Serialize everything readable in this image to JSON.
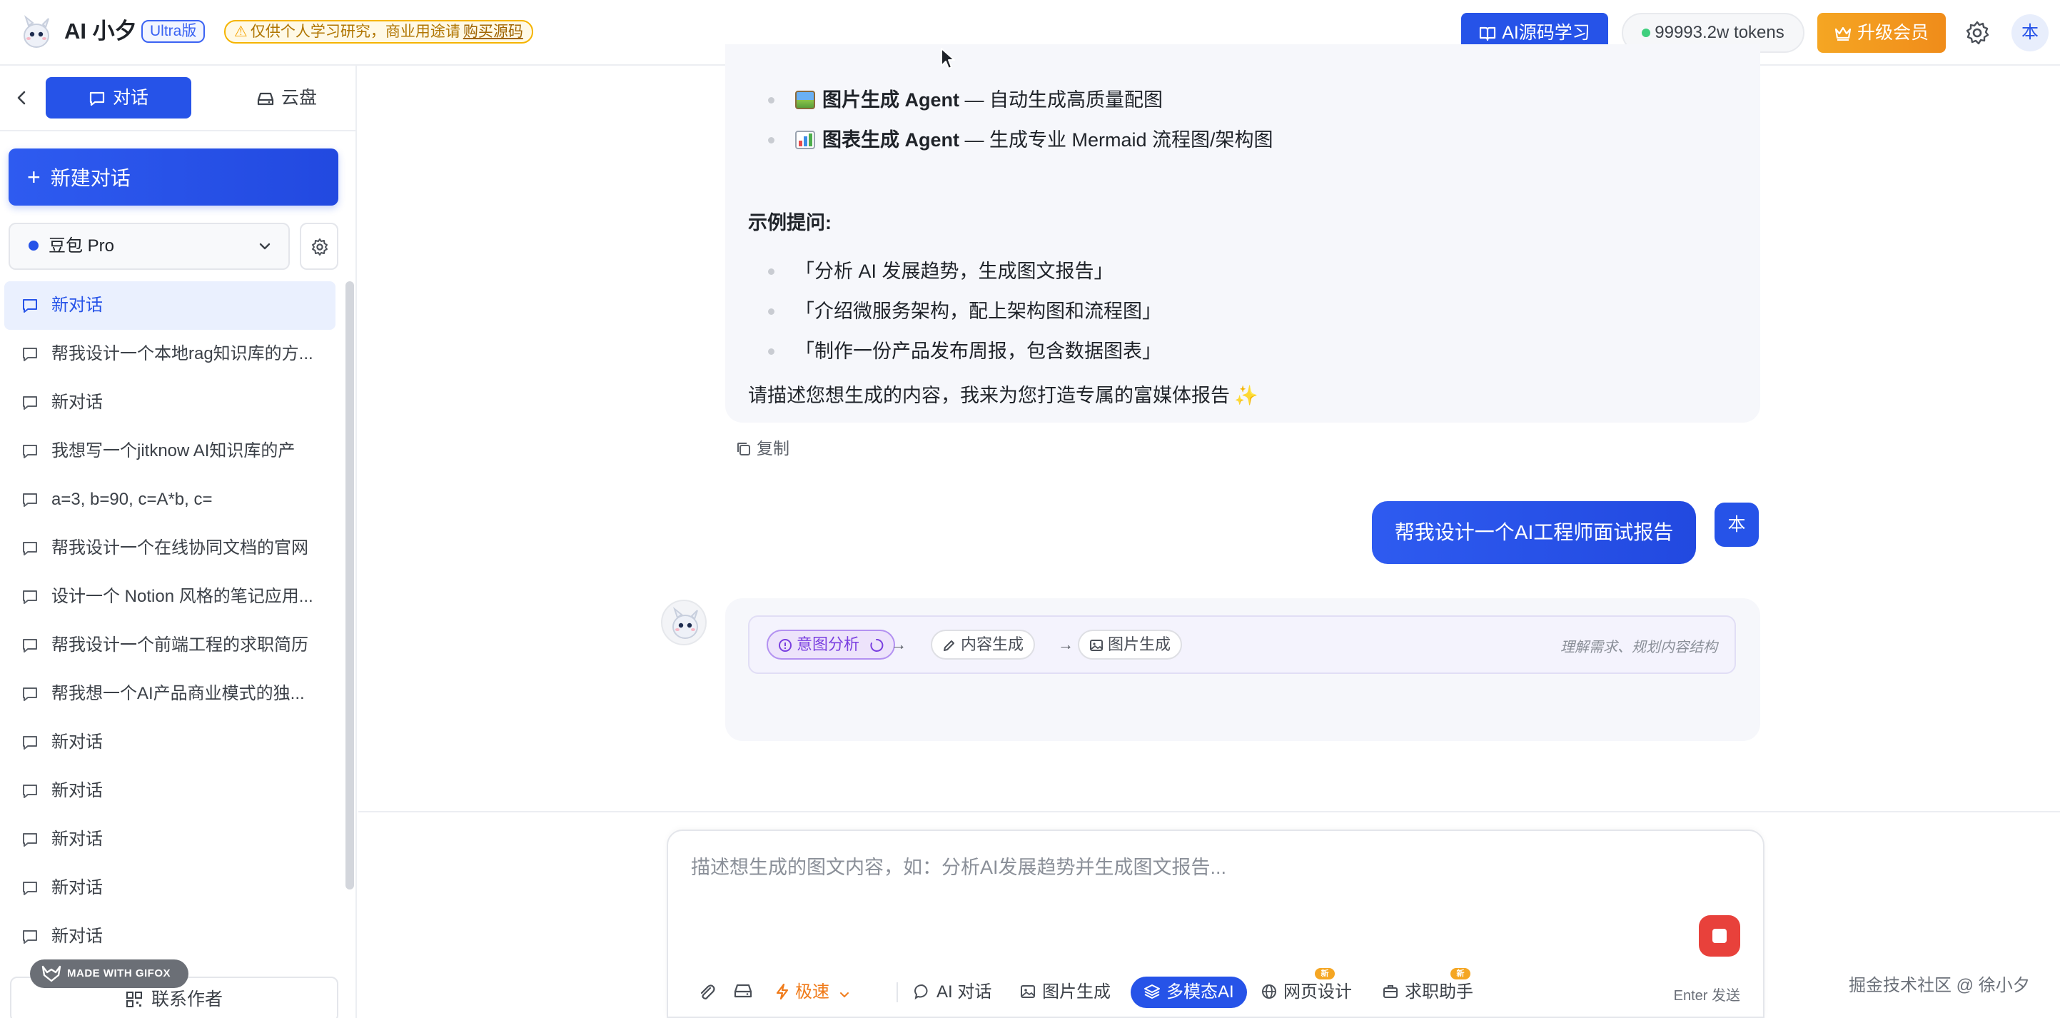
{
  "header": {
    "app_name": "AI 小夕",
    "edition_badge": "Ultra版",
    "notice_text": "仅供个人学习研究，商业用途请",
    "notice_link": "购买源码",
    "source_button": "AI源码学习",
    "tokens": "99993.2w tokens",
    "upgrade_button": "升级会员",
    "user_avatar": "本"
  },
  "sidebar": {
    "tab_chat": "对话",
    "tab_cloud": "云盘",
    "new_chat": "新建对话",
    "model": "豆包 Pro",
    "conversations": [
      "新对话",
      "帮我设计一个本地rag知识库的方...",
      "新对话",
      "我想写一个jitknow AI知识库的产",
      "a=3, b=90, c=A*b, c=",
      "帮我设计一个在线协同文档的官网",
      "设计一个 Notion 风格的笔记应用...",
      "帮我设计一个前端工程的求职简历",
      "帮我想一个AI产品商业模式的独...",
      "新对话",
      "新对话",
      "新对话",
      "新对话",
      "新对话"
    ],
    "gifox": "MADE WITH GIFOX",
    "contact": "联系作者"
  },
  "chat": {
    "agents": [
      {
        "name": "图片生成 Agent",
        "desc": " — 自动生成高质量配图"
      },
      {
        "name": "图表生成 Agent",
        "desc": " — 生成专业 Mermaid 流程图/架构图"
      }
    ],
    "examples_title": "示例提问:",
    "examples": [
      "「分析 AI 发展趋势，生成图文报告」",
      "「介绍微服务架构，配上架构图和流程图」",
      "「制作一份产品发布周报，包含数据图表」"
    ],
    "closing": "请描述您想生成的内容，我来为您打造专属的富媒体报告",
    "copy": "复制",
    "user_message": "帮我设计一个AI工程师面试报告",
    "user_avatar": "本",
    "pipeline": {
      "steps": [
        "意图分析",
        "内容生成",
        "图片生成"
      ],
      "hint": "理解需求、规划内容结构"
    }
  },
  "composer": {
    "placeholder": "描述想生成的图文内容，如：分析AI发展趋势并生成图文报告...",
    "speed": "极速",
    "tools": [
      "AI 对话",
      "图片生成",
      "多模态AI",
      "网页设计",
      "求职助手"
    ],
    "new_badge": "新",
    "enter_hint": "Enter 发送"
  },
  "watermark": "掘金技术社区 @ 徐小夕",
  "colors": {
    "primary": "#2653e8",
    "upgrade": "#f5a623",
    "stop": "#e8413b",
    "active_step": "#7a3fe0"
  }
}
